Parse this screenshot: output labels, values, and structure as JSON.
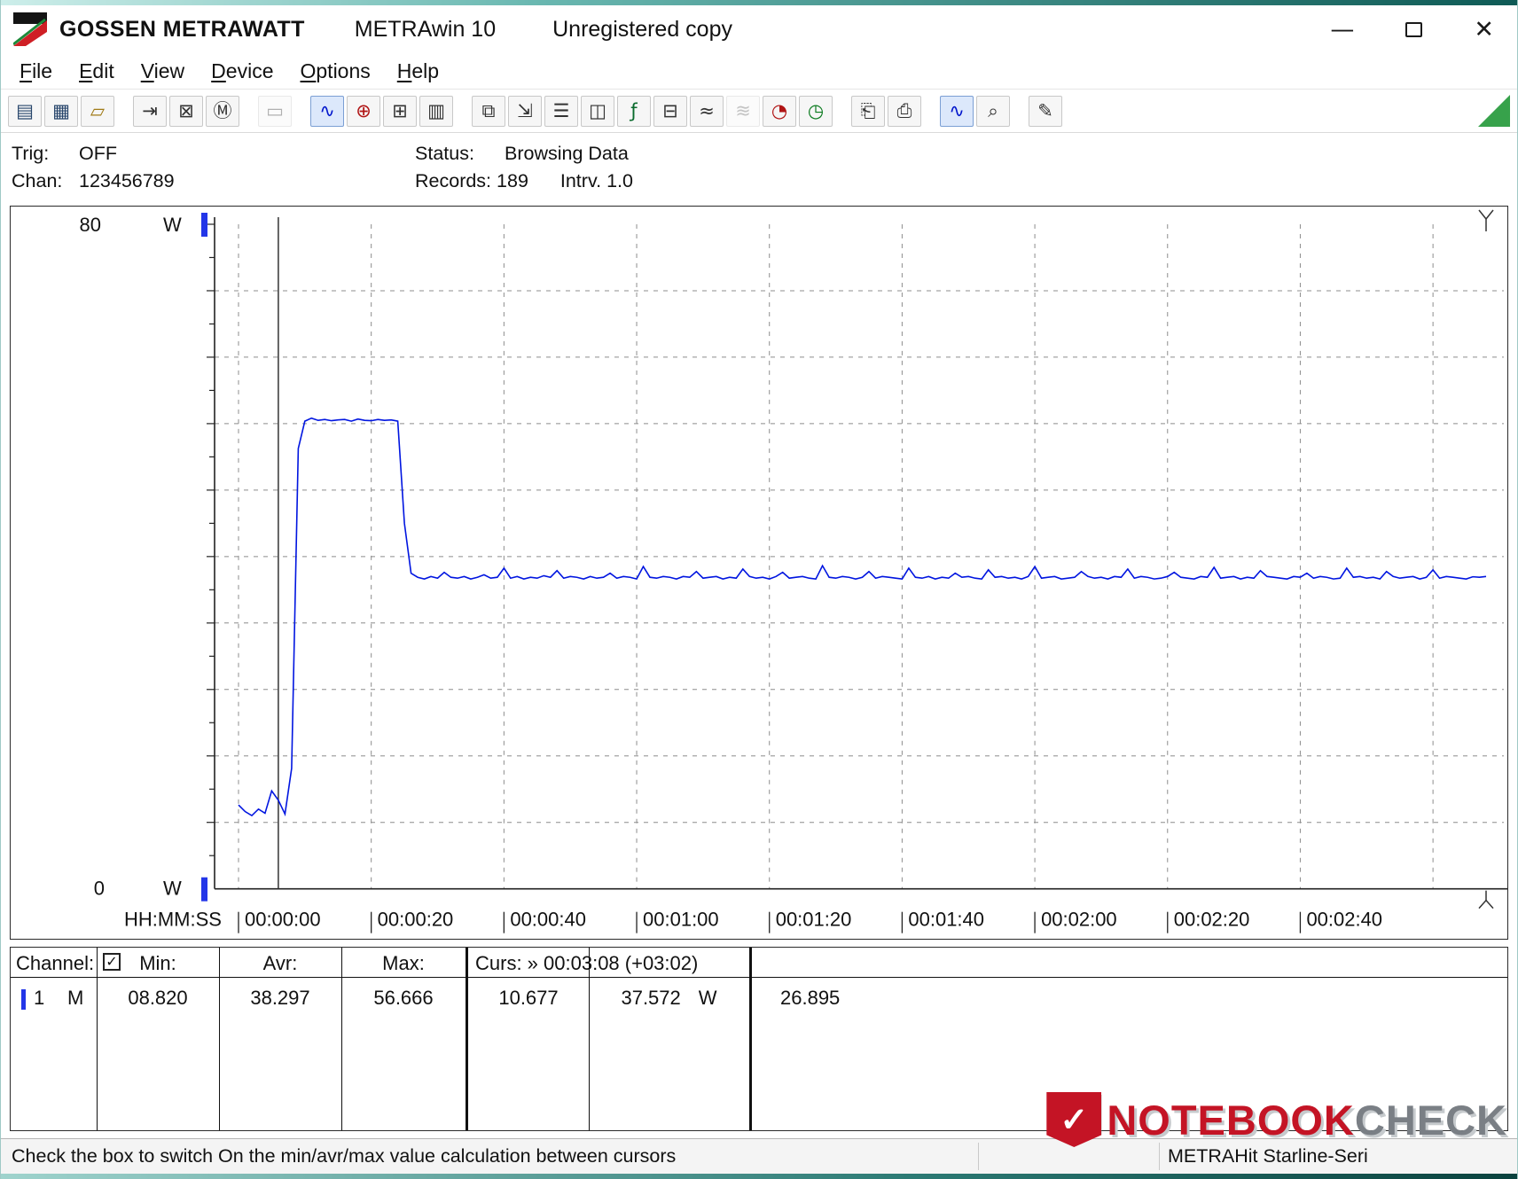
{
  "window": {
    "brand": "GOSSEN METRAWATT",
    "app_name": "METRAwin 10",
    "license": "Unregistered copy",
    "controls": {
      "minimize_glyph": "—",
      "close_glyph": "✕"
    }
  },
  "menu": {
    "items": [
      "File",
      "Edit",
      "View",
      "Device",
      "Options",
      "Help"
    ]
  },
  "toolbar": {
    "buttons": [
      {
        "name": "save-button",
        "icon": "floppy-disk-icon",
        "glyph": "▤",
        "color": "#27456b",
        "state": "normal"
      },
      {
        "name": "save-as-button",
        "icon": "floppy-export-icon",
        "glyph": "▦",
        "color": "#27456b",
        "state": "normal"
      },
      {
        "name": "open-file-button",
        "icon": "open-folder-icon",
        "glyph": "▱",
        "color": "#a07a16",
        "state": "normal"
      },
      {
        "gap": true
      },
      {
        "name": "export-data-button",
        "icon": "export-arrow-icon",
        "glyph": "⇥",
        "color": "#333333",
        "state": "normal"
      },
      {
        "name": "compress-data-button",
        "icon": "compress-icon",
        "glyph": "⊠",
        "color": "#333333",
        "state": "normal"
      },
      {
        "name": "memory-card-button",
        "icon": "memory-icon",
        "glyph": "Ⓜ",
        "color": "#333333",
        "state": "normal"
      },
      {
        "gap": true
      },
      {
        "name": "lcd-display-button",
        "icon": "lcd-icon",
        "glyph": "▭",
        "color": "#333333",
        "state": "disabled"
      },
      {
        "gap": true
      },
      {
        "name": "line-chart-view-button",
        "icon": "line-chart-icon",
        "glyph": "∿",
        "color": "#0015cc",
        "state": "pressed"
      },
      {
        "name": "scope-view-button",
        "icon": "crosshair-icon",
        "glyph": "⊕",
        "color": "#b01414",
        "state": "normal"
      },
      {
        "name": "table-view-button",
        "icon": "data-table-icon",
        "glyph": "⊞",
        "color": "#333333",
        "state": "normal"
      },
      {
        "name": "bar-chart-view-button",
        "icon": "bar-chart-icon",
        "glyph": "▥",
        "color": "#333333",
        "state": "normal"
      },
      {
        "gap": true
      },
      {
        "name": "transfer-settings-button",
        "icon": "window-export-icon",
        "glyph": "⧉",
        "color": "#333333",
        "state": "normal"
      },
      {
        "name": "device-config-button",
        "icon": "window-import-icon",
        "glyph": "⇲",
        "color": "#333333",
        "state": "normal"
      },
      {
        "name": "event-log-button",
        "icon": "list-icon",
        "glyph": "☰",
        "color": "#333333",
        "state": "normal"
      },
      {
        "name": "monitor-button",
        "icon": "monitor-icon",
        "glyph": "◫",
        "color": "#333333",
        "state": "normal"
      },
      {
        "name": "formula-button",
        "icon": "fx-icon",
        "glyph": "ƒ",
        "color": "#0a6b2d",
        "state": "normal"
      },
      {
        "name": "display-values-button",
        "icon": "calculator-icon",
        "glyph": "⊟",
        "color": "#333333",
        "state": "normal"
      },
      {
        "name": "split-curve-button",
        "icon": "dual-wave-icon",
        "glyph": "≈",
        "color": "#333333",
        "state": "normal"
      },
      {
        "name": "envelope-curve-button",
        "icon": "envelope-wave-icon",
        "glyph": "≋",
        "color": "#666666",
        "state": "disabled"
      },
      {
        "name": "battery-status-button",
        "icon": "battery-icon",
        "glyph": "◔",
        "color": "#b01414",
        "state": "normal"
      },
      {
        "name": "timer-button",
        "icon": "clock-icon",
        "glyph": "◷",
        "color": "#0a7a1e",
        "state": "normal"
      },
      {
        "gap": true
      },
      {
        "name": "print-preview-button",
        "icon": "print-preview-icon",
        "glyph": "⎗",
        "color": "#333333",
        "state": "normal"
      },
      {
        "name": "print-button",
        "icon": "printer-icon",
        "glyph": "⎙",
        "color": "#333333",
        "state": "normal"
      },
      {
        "gap": true
      },
      {
        "name": "zoom-time-button",
        "icon": "zoom-wave-icon",
        "glyph": "∿",
        "color": "#0015cc",
        "state": "pressed"
      },
      {
        "name": "zoom-lens-button",
        "icon": "magnifier-icon",
        "glyph": "⌕",
        "color": "#333333",
        "state": "normal"
      },
      {
        "gap": true
      },
      {
        "name": "annotation-button",
        "icon": "text-label-icon",
        "glyph": "✎",
        "color": "#333333",
        "state": "normal"
      }
    ]
  },
  "session": {
    "trig_label": "Trig:",
    "trig_value": "OFF",
    "chan_label": "Chan:",
    "chan_value": "123456789",
    "status_label": "Status:",
    "status_value": "Browsing Data",
    "records_label": "Records:",
    "records_value": "189",
    "interval_label": "Intrv.",
    "interval_value": "1.0"
  },
  "chart": {
    "y_top_label": "80",
    "y_top_unit": "W",
    "y_bottom_label": "0",
    "y_bottom_unit": "W",
    "x_axis_title": "HH:MM:SS",
    "x_ticks": [
      "00:00:00",
      "00:00:20",
      "00:00:40",
      "00:01:00",
      "00:01:20",
      "00:01:40",
      "00:02:00",
      "00:02:20",
      "00:02:40"
    ],
    "line_color": "#0015e0"
  },
  "chart_data": {
    "type": "line",
    "title": "METRAwin 10 power log, channel 1",
    "xlabel": "HH:MM:SS",
    "ylabel": "W",
    "ylim": [
      0,
      80
    ],
    "xlim_s": [
      0,
      188
    ],
    "x_tick_interval_s": 20,
    "y_grid_interval_w": 8,
    "grid": true,
    "x_start_s": 0,
    "interval_s": 1.0,
    "cursors": {
      "cursor1_time_s": 6,
      "cursor1_value": 10.677,
      "cursor2_time_s": 188,
      "cursor2_value": 37.572,
      "delta_value": 26.895,
      "delta_time": "+03:02"
    },
    "series": [
      {
        "name": "Channel 1 (W)",
        "values": [
          10.1,
          9.3,
          8.82,
          9.6,
          9.1,
          11.8,
          10.677,
          9.0,
          14.5,
          53.0,
          56.3,
          56.666,
          56.4,
          56.5,
          56.35,
          56.45,
          56.5,
          56.3,
          56.55,
          56.4,
          56.35,
          56.5,
          56.4,
          56.45,
          56.3,
          44.0,
          38.0,
          37.5,
          37.3,
          37.6,
          37.4,
          38.1,
          37.5,
          37.4,
          37.6,
          37.3,
          37.5,
          37.8,
          37.4,
          37.5,
          38.6,
          37.4,
          37.6,
          37.3,
          37.5,
          37.4,
          37.7,
          37.5,
          38.3,
          37.4,
          37.6,
          37.5,
          37.3,
          37.6,
          37.4,
          37.5,
          38.0,
          37.4,
          37.6,
          37.5,
          37.3,
          38.8,
          37.5,
          37.4,
          37.6,
          37.5,
          37.3,
          37.6,
          37.5,
          38.2,
          37.4,
          37.5,
          37.6,
          37.3,
          37.5,
          37.4,
          38.5,
          37.6,
          37.4,
          37.5,
          37.3,
          37.6,
          38.1,
          37.4,
          37.5,
          37.6,
          37.4,
          37.3,
          38.9,
          37.5,
          37.4,
          37.6,
          37.5,
          37.3,
          37.5,
          38.2,
          37.4,
          37.6,
          37.5,
          37.4,
          37.3,
          38.6,
          37.5,
          37.4,
          37.6,
          37.3,
          37.5,
          37.4,
          38.0,
          37.5,
          37.6,
          37.4,
          37.3,
          38.4,
          37.5,
          37.6,
          37.4,
          37.5,
          37.3,
          37.6,
          38.8,
          37.4,
          37.5,
          37.6,
          37.3,
          37.4,
          37.5,
          38.2,
          37.6,
          37.4,
          37.5,
          37.3,
          37.6,
          37.5,
          38.5,
          37.4,
          37.6,
          37.5,
          37.3,
          37.4,
          37.6,
          38.1,
          37.5,
          37.4,
          37.3,
          37.6,
          37.5,
          38.7,
          37.4,
          37.5,
          37.6,
          37.3,
          37.5,
          37.4,
          38.3,
          37.6,
          37.5,
          37.4,
          37.3,
          37.6,
          37.5,
          38.0,
          37.4,
          37.6,
          37.5,
          37.3,
          37.4,
          38.6,
          37.5,
          37.6,
          37.4,
          37.5,
          37.3,
          38.2,
          37.6,
          37.4,
          37.5,
          37.6,
          37.3,
          37.5,
          38.4,
          37.4,
          37.6,
          37.5,
          37.4,
          37.3,
          37.572,
          37.5,
          37.6
        ]
      }
    ]
  },
  "datapanel": {
    "channel_label": "Channel:",
    "checkbox_glyph": "✓",
    "min_label": "Min:",
    "avr_label": "Avr:",
    "max_label": "Max:",
    "curs_label": "Curs: » 00:03:08 (+03:02)",
    "row": {
      "channel": "1",
      "mode": "M",
      "min": "08.820",
      "avr": "38.297",
      "max": "56.666",
      "curs1": "10.677",
      "curs2": "37.572",
      "curs2_unit": "W",
      "delta": "26.895"
    }
  },
  "statusbar": {
    "message": "Check the box to switch On the min/avr/max value calculation between cursors",
    "device": "METRAHit Starline-Seri"
  },
  "watermark": {
    "check_glyph": "✓",
    "brand_red": "NOTEBOOK",
    "brand_gray": "CHECK"
  }
}
